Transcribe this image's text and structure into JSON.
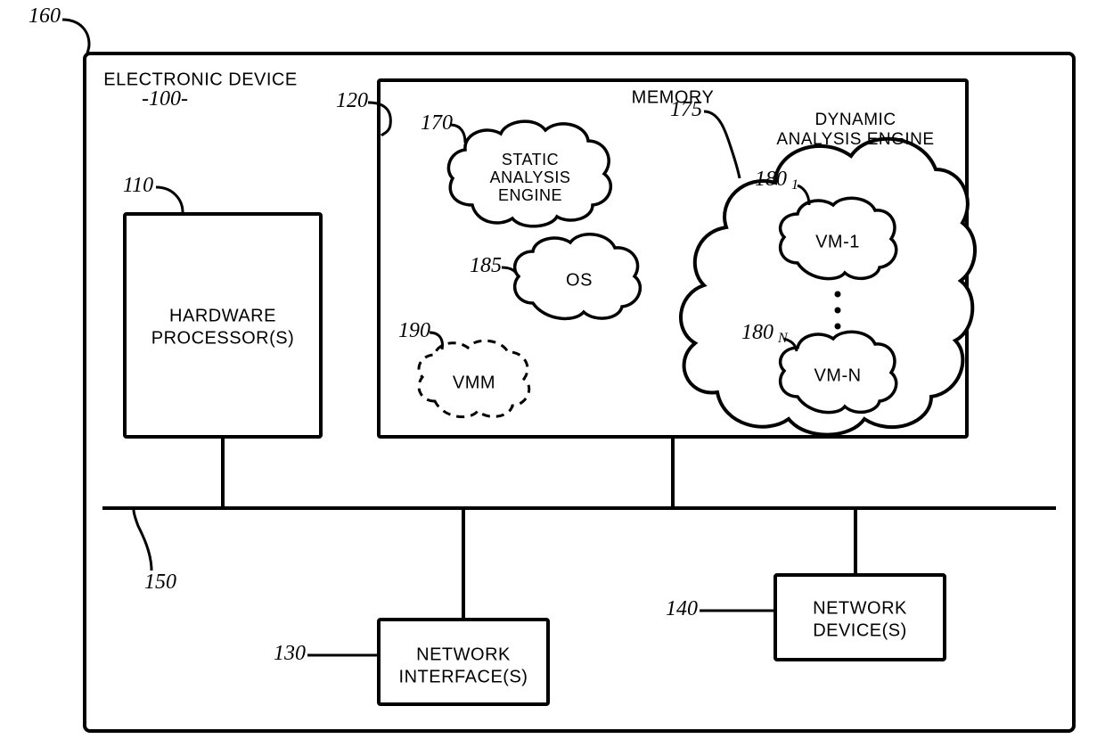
{
  "outer": {
    "ref": "160"
  },
  "device": {
    "title": "ELECTRONIC DEVICE",
    "ref": "-100-"
  },
  "processor": {
    "label_l1": "HARDWARE",
    "label_l2": "PROCESSOR(S)",
    "ref": "110"
  },
  "memory": {
    "title": "MEMORY",
    "ref": "120"
  },
  "static_engine": {
    "label_l1": "STATIC",
    "label_l2": "ANALYSIS",
    "label_l3": "ENGINE",
    "ref": "170"
  },
  "dynamic_engine": {
    "label_l1": "DYNAMIC",
    "label_l2": "ANALYSIS ENGINE",
    "ref": "175"
  },
  "vm1": {
    "label": "VM-1",
    "ref": "180",
    "sub": "1"
  },
  "vmn": {
    "label": "VM-N",
    "ref": "180",
    "sub": "N"
  },
  "os": {
    "label": "OS",
    "ref": "185"
  },
  "vmm": {
    "label": "VMM",
    "ref": "190"
  },
  "bus": {
    "ref": "150"
  },
  "net_if": {
    "label_l1": "NETWORK",
    "label_l2": "INTERFACE(S)",
    "ref": "130"
  },
  "net_dev": {
    "label_l1": "NETWORK",
    "label_l2": "DEVICE(S)",
    "ref": "140"
  }
}
